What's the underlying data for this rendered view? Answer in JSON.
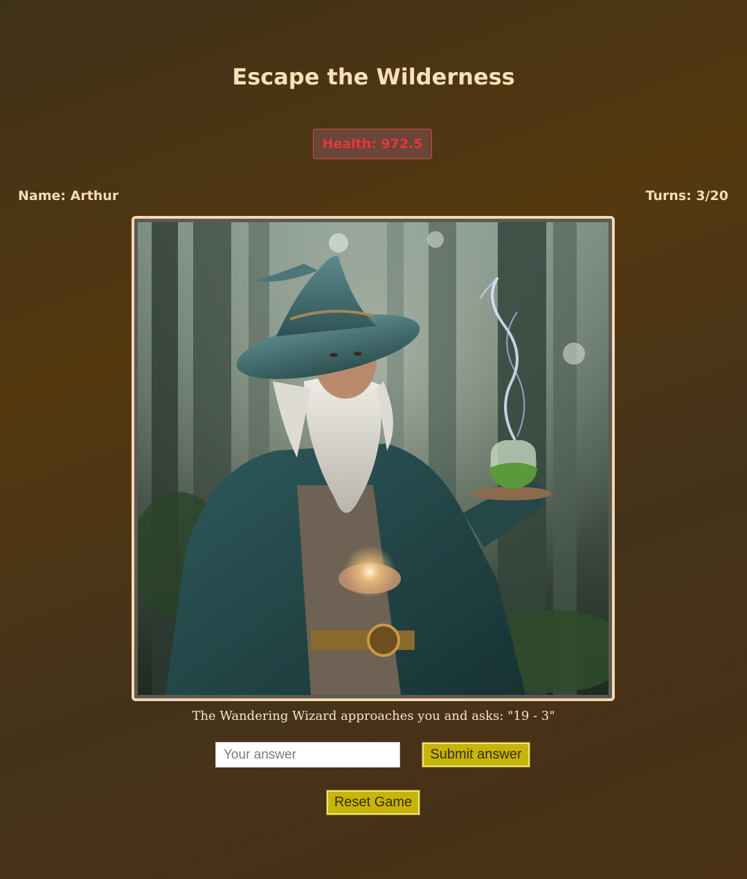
{
  "game": {
    "title": "Escape the Wilderness"
  },
  "status": {
    "health_label": "Health: 972.5",
    "name_label": "Name: Arthur",
    "turns_label": "Turns: 3/20"
  },
  "encounter": {
    "image_subject": "wandering-wizard-illustration",
    "prompt_text": "The Wandering Wizard approaches you and asks: \"19 - 3\""
  },
  "answer_form": {
    "input_value": "",
    "input_placeholder": "Your answer",
    "submit_label": "Submit answer"
  },
  "controls": {
    "reset_label": "Reset Game"
  },
  "colors": {
    "background": "#4a3416",
    "title_text": "#f9e0b8",
    "health_text": "#e8373b",
    "health_border": "#d94a44",
    "button_fill": "#c6b409",
    "image_border": "#f8d8b0"
  }
}
